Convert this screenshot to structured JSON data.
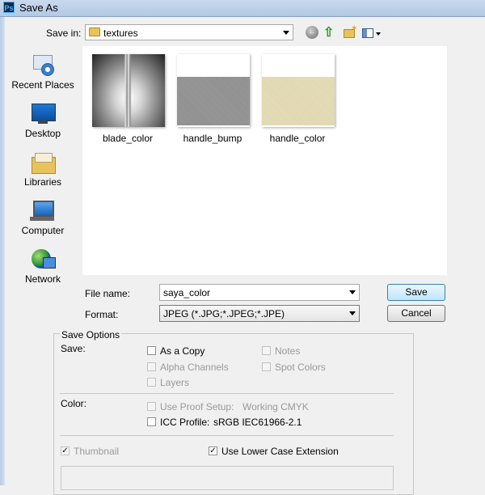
{
  "window": {
    "title": "Save As",
    "app_icon": "Ps"
  },
  "toolbar": {
    "save_in_label": "Save in:",
    "save_in_value": "textures",
    "back_icon": "back-arrow-icon",
    "up_icon": "up-folder-icon",
    "new_folder_icon": "new-folder-icon",
    "view_menu_icon": "view-menu-icon"
  },
  "places": [
    {
      "label": "Recent Places",
      "icon": "recent-places-icon"
    },
    {
      "label": "Desktop",
      "icon": "desktop-icon"
    },
    {
      "label": "Libraries",
      "icon": "libraries-icon"
    },
    {
      "label": "Computer",
      "icon": "computer-icon"
    },
    {
      "label": "Network",
      "icon": "network-icon"
    }
  ],
  "files": [
    {
      "name": "blade_color"
    },
    {
      "name": "handle_bump"
    },
    {
      "name": "handle_color"
    }
  ],
  "form": {
    "file_name_label": "File name:",
    "file_name_value": "saya_color",
    "format_label": "Format:",
    "format_value": "JPEG (*.JPG;*.JPEG;*.JPE)",
    "save_button": "Save",
    "cancel_button": "Cancel"
  },
  "options": {
    "title": "Save Options",
    "save_label": "Save:",
    "as_a_copy": {
      "label": "As a Copy",
      "checked": false,
      "enabled": true
    },
    "notes": {
      "label": "Notes",
      "checked": false,
      "enabled": false
    },
    "alpha_channels": {
      "label": "Alpha Channels",
      "checked": false,
      "enabled": false
    },
    "spot_colors": {
      "label": "Spot Colors",
      "checked": false,
      "enabled": false
    },
    "layers": {
      "label": "Layers",
      "checked": false,
      "enabled": false
    },
    "color_label": "Color:",
    "use_proof_setup": {
      "label": "Use Proof Setup:",
      "value": "Working CMYK",
      "checked": false,
      "enabled": false
    },
    "icc_profile": {
      "label": "ICC Profile:",
      "value": "sRGB IEC61966-2.1",
      "checked": false,
      "enabled": true
    },
    "thumbnail": {
      "label": "Thumbnail",
      "checked": true,
      "enabled": false
    },
    "lower_case_ext": {
      "label": "Use Lower Case Extension",
      "checked": true,
      "enabled": true
    }
  }
}
